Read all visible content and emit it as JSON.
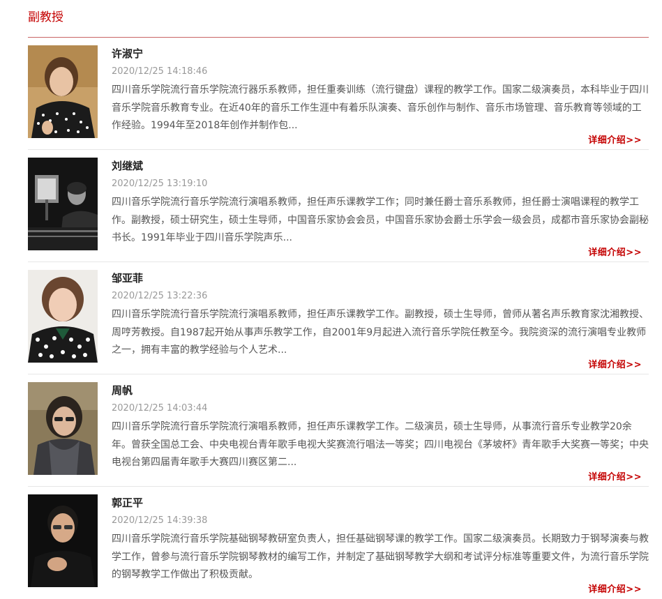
{
  "section": {
    "title": "副教授"
  },
  "teachers": [
    {
      "name": "许淑宁",
      "date": "2020/12/25 14:18:46",
      "desc": "四川音乐学院流行音乐学院流行器乐系教师，担任重奏训练（流行键盘）课程的教学工作。国家二级演奏员，本科毕业于四川音乐学院音乐教育专业。在近40年的音乐工作生涯中有着乐队演奏、音乐创作与制作、音乐市场管理、音乐教育等领域的工作经验。1994年至2018年创作并制作包...",
      "more": "详细介绍>>"
    },
    {
      "name": "刘继斌",
      "date": "2020/12/25 13:19:10",
      "desc": "四川音乐学院流行音乐学院流行演唱系教师，担任声乐课教学工作；同时兼任爵士音乐系教师，担任爵士演唱课程的教学工作。副教授，硕士研究生，硕士生导师，中国音乐家协会会员，中国音乐家协会爵士乐学会一级会员，成都市音乐家协会副秘书长。1991年毕业于四川音乐学院声乐...",
      "more": "详细介绍>>"
    },
    {
      "name": "邹亚菲",
      "date": "2020/12/25 13:22:36",
      "desc": "四川音乐学院流行音乐学院流行演唱系教师，担任声乐课教学工作。副教授，硕士生导师，曾师从著名声乐教育家沈湘教授、周哼芳教授。自1987起开始从事声乐教学工作，自2001年9月起进入流行音乐学院任教至今。我院资深的流行演唱专业教师之一，拥有丰富的教学经验与个人艺术...",
      "more": "详细介绍>>"
    },
    {
      "name": "周帆",
      "date": "2020/12/25 14:03:44",
      "desc": "四川音乐学院流行音乐学院流行演唱系教师，担任声乐课教学工作。二级演员，硕士生导师，从事流行音乐专业教学20余年。曾获全国总工会、中央电视台青年歌手电视大奖赛流行唱法一等奖；四川电视台《茅坡杯》青年歌手大奖赛一等奖；中央电视台第四届青年歌手大赛四川赛区第二...",
      "more": "详细介绍>>"
    },
    {
      "name": "郭正平",
      "date": "2020/12/25 14:39:38",
      "desc": "四川音乐学院流行音乐学院基础钢琴教研室负责人，担任基础钢琴课的教学工作。国家二级演奏员。长期致力于钢琴演奏与教学工作，曾参与流行音乐学院钢琴教材的编写工作，并制定了基础钢琴教学大纲和考试评分标准等重要文件，为流行音乐学院的钢琴教学工作做出了积极贡献。",
      "more": "详细介绍>>"
    }
  ]
}
